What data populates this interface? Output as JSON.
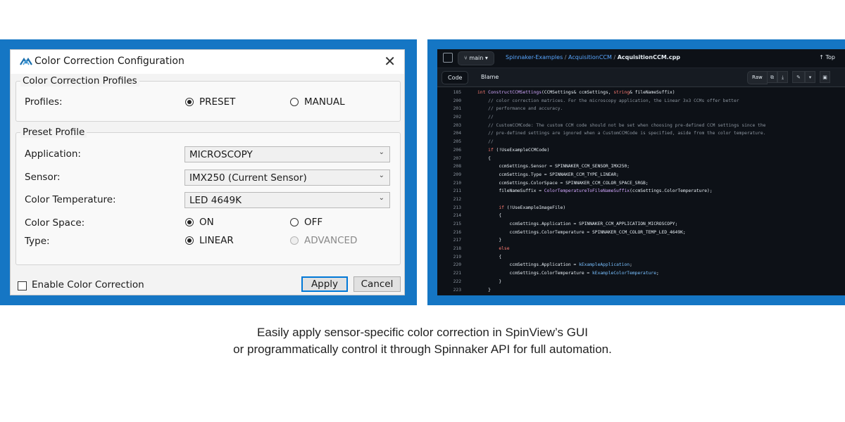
{
  "dialog": {
    "title": "Color Correction Configuration",
    "close_glyph": "✕",
    "profiles_group": {
      "title": "Color Correction Profiles",
      "label": "Profiles:",
      "options": [
        "PRESET",
        "MANUAL"
      ],
      "selected": "PRESET"
    },
    "preset_group": {
      "title": "Preset Profile",
      "application_label": "Application:",
      "application_value": "MICROSCOPY",
      "sensor_label": "Sensor:",
      "sensor_value": "IMX250 (Current Sensor)",
      "color_temp_label": "Color Temperature:",
      "color_temp_value": "LED 4649K",
      "color_space_label": "Color Space:",
      "color_space_options": [
        "ON",
        "OFF"
      ],
      "color_space_selected": "ON",
      "type_label": "Type:",
      "type_options": [
        "LINEAR",
        "ADVANCED"
      ],
      "type_selected": "LINEAR"
    },
    "enable_label": "Enable Color Correction",
    "enable_checked": false,
    "apply_label": "Apply",
    "cancel_label": "Cancel"
  },
  "code_view": {
    "branch": "main",
    "breadcrumb": [
      "Spinnaker-Examples",
      "AcquisitionCCM",
      "AcquisitionCCM.cpp"
    ],
    "top_label": "Top",
    "tabs": [
      "Code",
      "Blame"
    ],
    "raw_label": "Raw",
    "lines": [
      {
        "n": "185",
        "t": "int ConstructCCMSettings(CCMSettings& ccmSettings, string& fileNameSuffix)"
      },
      {
        "n": "200",
        "t": "    // color correction matrices. For the microscopy application, the Linear 3x3 CCMs offer better"
      },
      {
        "n": "201",
        "t": "    // performance and accuracy."
      },
      {
        "n": "202",
        "t": "    //"
      },
      {
        "n": "203",
        "t": "    // CustomCCMCode: The custom CCM code should not be set when choosing pre-defined CCM settings since the"
      },
      {
        "n": "204",
        "t": "    // pre-defined settings are ignored when a CustomCCMCode is specified, aside from the color temperature."
      },
      {
        "n": "205",
        "t": "    //"
      },
      {
        "n": "206",
        "t": "    if (!UseExampleCCMCode)"
      },
      {
        "n": "207",
        "t": "    {"
      },
      {
        "n": "208",
        "t": "        ccmSettings.Sensor = SPINNAKER_CCM_SENSOR_IMX250;"
      },
      {
        "n": "209",
        "t": "        ccmSettings.Type = SPINNAKER_CCM_TYPE_LINEAR;"
      },
      {
        "n": "210",
        "t": "        ccmSettings.ColorSpace = SPINNAKER_CCM_COLOR_SPACE_SRGB;"
      },
      {
        "n": "211",
        "t": "        fileNameSuffix = ColorTemperatureToFileNameSuffix(ccmSettings.ColorTemperature);"
      },
      {
        "n": "212",
        "t": ""
      },
      {
        "n": "213",
        "t": "        if (!UseExampleImageFile)"
      },
      {
        "n": "214",
        "t": "        {"
      },
      {
        "n": "215",
        "t": "            ccmSettings.Application = SPINNAKER_CCM_APPLICATION_MICROSCOPY;"
      },
      {
        "n": "216",
        "t": "            ccmSettings.ColorTemperature = SPINNAKER_CCM_COLOR_TEMP_LED_4649K;"
      },
      {
        "n": "217",
        "t": "        }"
      },
      {
        "n": "218",
        "t": "        else"
      },
      {
        "n": "219",
        "t": "        {"
      },
      {
        "n": "220",
        "t": "            ccmSettings.Application = kExampleApplication;"
      },
      {
        "n": "221",
        "t": "            ccmSettings.ColorTemperature = kExampleColorTemperature;"
      },
      {
        "n": "222",
        "t": "        }"
      },
      {
        "n": "223",
        "t": "    }"
      }
    ]
  },
  "caption": {
    "line1": "Easily apply sensor-specific color correction in SpinView’s GUI",
    "line2": "or programmatically control it through Spinnaker API for full automation."
  },
  "colors": {
    "frame_blue": "#1576c4",
    "code_bg": "#0d1117",
    "link": "#58a6ff"
  }
}
